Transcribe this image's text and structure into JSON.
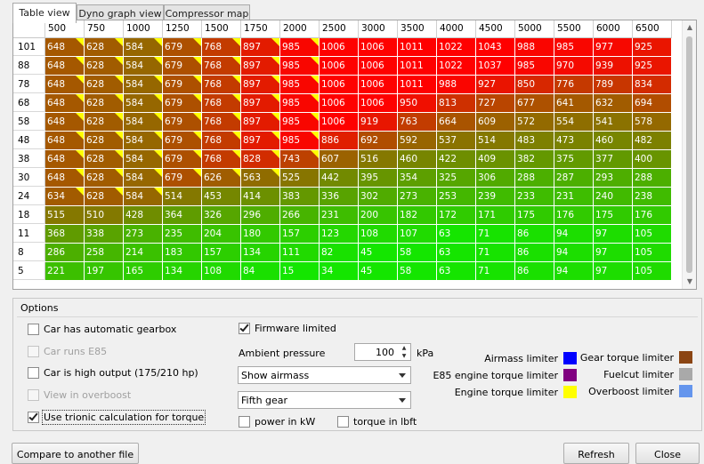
{
  "tabs": [
    {
      "label": "Table view",
      "active": true
    },
    {
      "label": "Dyno graph view",
      "active": false
    },
    {
      "label": "Compressor map",
      "active": false
    }
  ],
  "table": {
    "columns": [
      "500",
      "750",
      "1000",
      "1250",
      "1500",
      "1750",
      "2000",
      "2500",
      "3000",
      "3500",
      "4000",
      "4500",
      "5000",
      "5500",
      "6000",
      "6500"
    ],
    "rows": [
      {
        "label": "101",
        "values": [
          648,
          628,
          584,
          679,
          768,
          897,
          985,
          1006,
          1006,
          1011,
          1022,
          1043,
          988,
          985,
          977,
          925
        ]
      },
      {
        "label": "88",
        "values": [
          648,
          628,
          584,
          679,
          768,
          897,
          985,
          1006,
          1006,
          1011,
          1022,
          1037,
          985,
          970,
          939,
          925
        ]
      },
      {
        "label": "78",
        "values": [
          648,
          628,
          584,
          679,
          768,
          897,
          985,
          1006,
          1006,
          1011,
          988,
          927,
          850,
          776,
          789,
          834
        ]
      },
      {
        "label": "68",
        "values": [
          648,
          628,
          584,
          679,
          768,
          897,
          985,
          1006,
          1006,
          950,
          813,
          727,
          677,
          641,
          632,
          694
        ]
      },
      {
        "label": "58",
        "values": [
          648,
          628,
          584,
          679,
          768,
          897,
          985,
          1006,
          919,
          763,
          664,
          609,
          572,
          554,
          541,
          578
        ]
      },
      {
        "label": "48",
        "values": [
          648,
          628,
          584,
          679,
          768,
          897,
          985,
          886,
          692,
          592,
          537,
          514,
          483,
          473,
          460,
          482
        ]
      },
      {
        "label": "38",
        "values": [
          648,
          628,
          584,
          679,
          768,
          828,
          743,
          607,
          516,
          460,
          422,
          409,
          382,
          375,
          377,
          400
        ]
      },
      {
        "label": "30",
        "values": [
          648,
          628,
          584,
          679,
          626,
          563,
          525,
          442,
          395,
          354,
          325,
          306,
          288,
          287,
          293,
          288
        ]
      },
      {
        "label": "24",
        "values": [
          634,
          628,
          584,
          514,
          453,
          414,
          383,
          336,
          302,
          273,
          253,
          239,
          233,
          231,
          240,
          238
        ]
      },
      {
        "label": "18",
        "values": [
          515,
          510,
          428,
          364,
          326,
          296,
          266,
          231,
          200,
          182,
          172,
          171,
          175,
          176,
          175,
          176
        ]
      },
      {
        "label": "11",
        "values": [
          368,
          338,
          273,
          235,
          204,
          180,
          157,
          123,
          108,
          107,
          63,
          71,
          86,
          94,
          97,
          105
        ]
      },
      {
        "label": "8",
        "values": [
          286,
          258,
          214,
          183,
          157,
          134,
          111,
          82,
          45,
          58,
          63,
          71,
          86,
          94,
          97,
          105
        ]
      },
      {
        "label": "5",
        "values": [
          221,
          197,
          165,
          134,
          108,
          84,
          15,
          34,
          45,
          58,
          63,
          71,
          86,
          94,
          97,
          105
        ]
      }
    ]
  },
  "options": {
    "title": "Options",
    "auto_gearbox": "Car has automatic gearbox",
    "runs_e85": "Car runs E85",
    "high_output": "Car is high output (175/210 hp)",
    "overboost": "View in overboost",
    "trionic_calc": "Use trionic calculation for torque",
    "firmware_limited": "Firmware limited",
    "ambient_label": "Ambient pressure",
    "ambient_value": "100",
    "ambient_unit": "kPa",
    "view_select": "Show airmass",
    "gear_select": "Fifth gear",
    "power_kw": "power in kW",
    "torque_lbft": "torque in lbft"
  },
  "legend": [
    {
      "label": "Airmass limiter",
      "color": "#0000ff"
    },
    {
      "label": "E85 engine torque limiter",
      "color": "#800080"
    },
    {
      "label": "Engine torque limiter",
      "color": "#ffff00"
    },
    {
      "label": "Gear torque limiter",
      "color": "#8b4513"
    },
    {
      "label": "Fuelcut limiter",
      "color": "#a9a9a9"
    },
    {
      "label": "Overboost limiter",
      "color": "#6495ed"
    }
  ],
  "buttons": {
    "compare": "Compare to another file",
    "refresh": "Refresh",
    "close": "Close"
  }
}
